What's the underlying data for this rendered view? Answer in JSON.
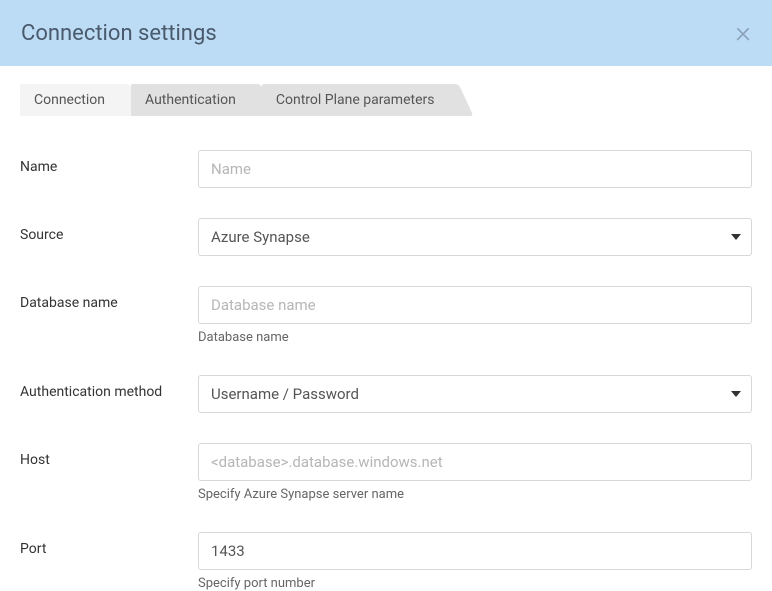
{
  "header": {
    "title": "Connection settings",
    "close_glyph": "×"
  },
  "tabs": {
    "connection": "Connection",
    "authentication": "Authentication",
    "control_plane": "Control Plane parameters"
  },
  "form": {
    "name": {
      "label": "Name",
      "placeholder": "Name",
      "value": ""
    },
    "source": {
      "label": "Source",
      "value": "Azure Synapse"
    },
    "database": {
      "label": "Database name",
      "placeholder": "Database name",
      "value": "",
      "hint": "Database name"
    },
    "auth_method": {
      "label": "Authentication method",
      "value": "Username / Password"
    },
    "host": {
      "label": "Host",
      "placeholder": "<database>.database.windows.net",
      "value": "",
      "hint": "Specify Azure Synapse server name"
    },
    "port": {
      "label": "Port",
      "value": "1433",
      "hint": "Specify port number"
    }
  }
}
